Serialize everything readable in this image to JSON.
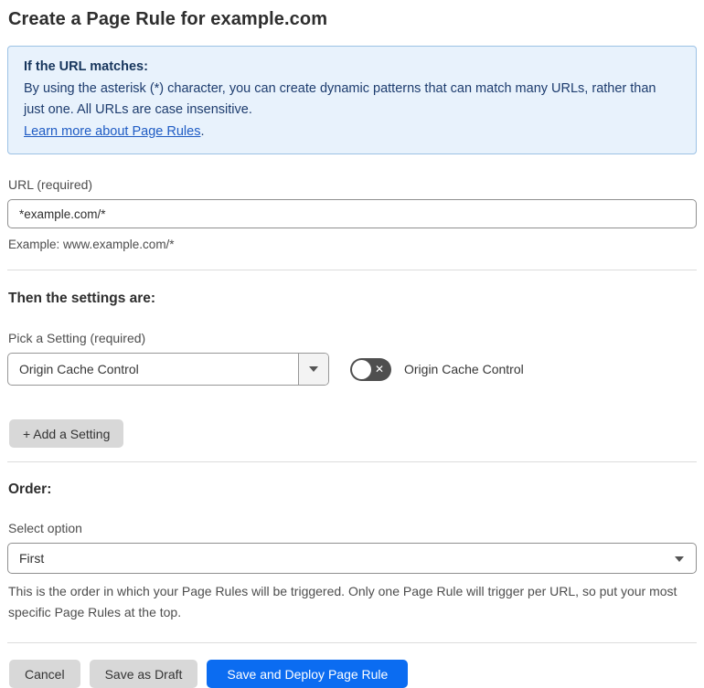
{
  "page": {
    "title": "Create a Page Rule for example.com"
  },
  "info_box": {
    "heading": "If the URL matches:",
    "body": "By using the asterisk (*) character, you can create dynamic patterns that can match many URLs, rather than just one. All URLs are case insensitive.",
    "link": "Learn more about Page Rules",
    "link_suffix": "."
  },
  "url_section": {
    "label": "URL (required)",
    "value": "*example.com/*",
    "example": "Example: www.example.com/*"
  },
  "settings_section": {
    "heading": "Then the settings are:",
    "pick_label": "Pick a Setting (required)",
    "selected_setting": "Origin Cache Control",
    "toggle_state": "off",
    "toggle_glyph": "✕",
    "toggle_label": "Origin Cache Control",
    "add_button": "+ Add a Setting"
  },
  "order_section": {
    "heading": "Order:",
    "select_label": "Select option",
    "selected_option": "First",
    "help": "This is the order in which your Page Rules will be triggered. Only one Page Rule will trigger per URL, so put your most specific Page Rules at the top."
  },
  "footer": {
    "cancel": "Cancel",
    "save_draft": "Save as Draft",
    "save_deploy": "Save and Deploy Page Rule"
  },
  "colors": {
    "accent_blue": "#0b6cf1",
    "info_bg": "#e8f2fc",
    "info_border": "#9cc2e5",
    "info_text": "#1d3c6e",
    "link_blue": "#1f5cc4",
    "toggle_off": "#4f4f4f",
    "button_gray": "#d8d8d8"
  }
}
